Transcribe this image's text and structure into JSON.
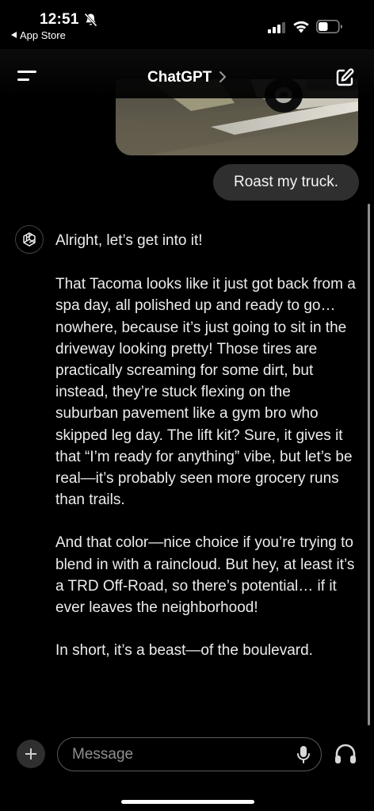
{
  "status_bar": {
    "time": "12:51",
    "back_app_label": "App Store",
    "icons": [
      "bell-slash-icon",
      "cellular-signal-icon",
      "wifi-icon",
      "battery-icon"
    ]
  },
  "header": {
    "title": "ChatGPT",
    "icons": [
      "menu-icon",
      "chevron-right-icon",
      "new-chat-icon"
    ]
  },
  "conversation": {
    "user_message": "Roast my truck.",
    "assistant_paragraphs": [
      "Alright, let’s get into it!",
      "That Tacoma looks like it just got back from a spa day, all polished up and ready to go… nowhere, because it’s just going to sit in the driveway looking pretty! Those tires are practically screaming for some dirt, but instead, they’re stuck flexing on the suburban pavement like a gym bro who skipped leg day. The lift kit? Sure, it gives it that “I’m ready for anything” vibe, but let’s be real—it’s probably seen more grocery runs than trails.",
      "And that color—nice choice if you’re trying to blend in with a raincloud. But hey, at least it’s a TRD Off-Road, so there’s potential… if it ever leaves the neighborhood!",
      "In short, it’s a beast—of the boulevard."
    ]
  },
  "composer": {
    "placeholder": "Message",
    "icons": [
      "plus-icon",
      "microphone-icon",
      "headphones-icon"
    ]
  },
  "colors": {
    "background": "#000000",
    "user_bubble": "#2f2f2f",
    "text": "#ececec",
    "placeholder": "#8f8f8f"
  }
}
